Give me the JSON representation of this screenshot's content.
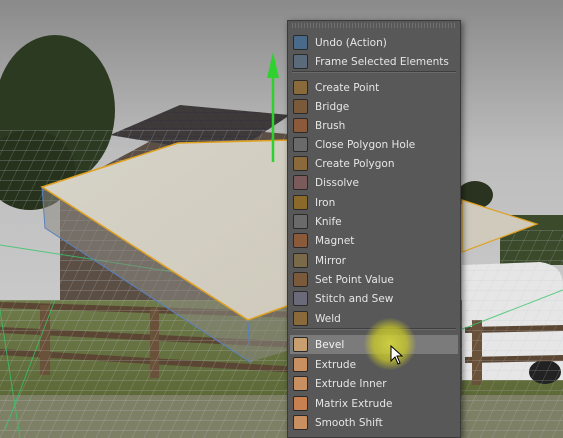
{
  "menu": {
    "items": [
      {
        "label": "Undo (Action)",
        "icon": "undo-icon",
        "color": "#4a6a8a"
      },
      {
        "label": "Frame Selected Elements",
        "icon": "frame-selected-icon",
        "color": "#5a6a7a"
      },
      {
        "label": "Create Point",
        "icon": "create-point-icon",
        "color": "#8a6a3a"
      },
      {
        "label": "Bridge",
        "icon": "bridge-icon",
        "color": "#7a5a3a"
      },
      {
        "label": "Brush",
        "icon": "brush-icon",
        "color": "#8a5a3a"
      },
      {
        "label": "Close Polygon Hole",
        "icon": "close-polygon-hole-icon",
        "color": "#6a6a6a"
      },
      {
        "label": "Create Polygon",
        "icon": "create-polygon-icon",
        "color": "#8a6a3a"
      },
      {
        "label": "Dissolve",
        "icon": "dissolve-icon",
        "color": "#7a5a5a"
      },
      {
        "label": "Iron",
        "icon": "iron-icon",
        "color": "#8a6a2a"
      },
      {
        "label": "Knife",
        "icon": "knife-icon",
        "color": "#6a6a6a"
      },
      {
        "label": "Magnet",
        "icon": "magnet-icon",
        "color": "#8a5a3a"
      },
      {
        "label": "Mirror",
        "icon": "mirror-icon",
        "color": "#7a6a4a"
      },
      {
        "label": "Set Point Value",
        "icon": "set-point-value-icon",
        "color": "#7a5a3a"
      },
      {
        "label": "Stitch and Sew",
        "icon": "stitch-and-sew-icon",
        "color": "#6a6a7a"
      },
      {
        "label": "Weld",
        "icon": "weld-icon",
        "color": "#8a6a3a"
      },
      {
        "label": "Bevel",
        "icon": "bevel-icon",
        "color": "#c8a070"
      },
      {
        "label": "Extrude",
        "icon": "extrude-icon",
        "color": "#c89060"
      },
      {
        "label": "Extrude Inner",
        "icon": "extrude-inner-icon",
        "color": "#c89060"
      },
      {
        "label": "Matrix Extrude",
        "icon": "matrix-extrude-icon",
        "color": "#c88050"
      },
      {
        "label": "Smooth Shift",
        "icon": "smooth-shift-icon",
        "color": "#c89060"
      }
    ],
    "highlighted": "Bevel"
  },
  "colors": {
    "menu_bg": "#585858",
    "highlight": "#7b7b7b",
    "axis_y": "#2fd12f",
    "selection_edge": "#e0a020",
    "wireframe": "#5a80c0"
  }
}
